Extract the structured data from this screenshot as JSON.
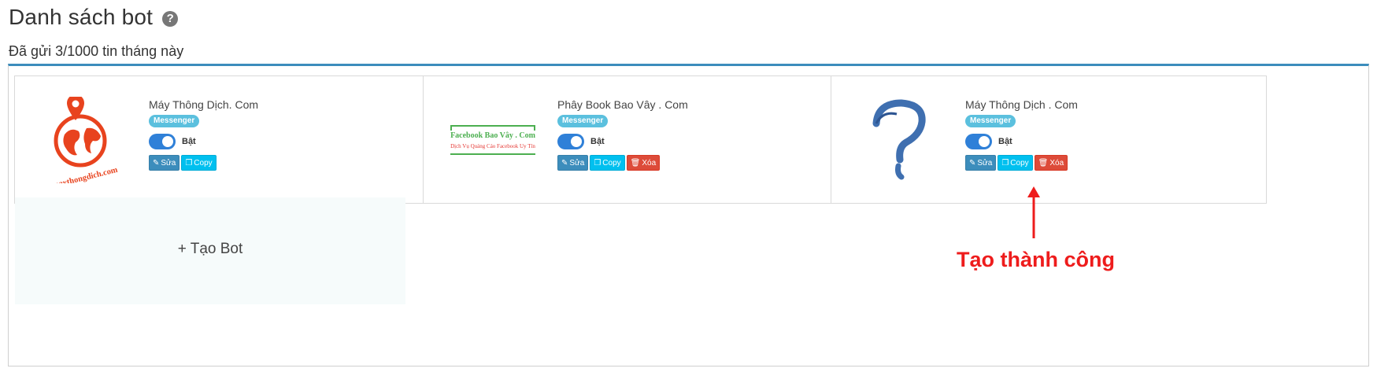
{
  "header": {
    "title": "Danh sách bot",
    "help_icon": "question-circle-icon",
    "sent_info": "Đã gửi 3/1000 tin tháng này"
  },
  "bots": [
    {
      "name": "Máy Thông Dịch. Com",
      "channel": "Messenger",
      "status_label": "Bật",
      "status_on": true,
      "logo": "maythongdich-globe-logo",
      "logo_text": "maythongdich.com",
      "edit_label": "Sửa",
      "copy_label": "Copy"
    },
    {
      "name": "Phây Book Bao Vây . Com",
      "channel": "Messenger",
      "status_label": "Bật",
      "status_on": true,
      "logo": "facebook-bao-vay-logo",
      "logo_line1": "Facebook Bao Vây . Com",
      "logo_line2": "Dịch Vụ Quảng Cáo Facebook Uy Tín",
      "edit_label": "Sửa",
      "copy_label": "Copy",
      "delete_label": "Xóa"
    },
    {
      "name": "Máy Thông Dịch . Com",
      "channel": "Messenger",
      "status_label": "Bật",
      "status_on": true,
      "logo": "question-mark-placeholder-logo",
      "edit_label": "Sửa",
      "copy_label": "Copy",
      "delete_label": "Xóa"
    }
  ],
  "create": {
    "label": "+ Tạo Bot"
  },
  "annotation": {
    "text": "Tạo thành công",
    "color": "#ee1c1c"
  },
  "colors": {
    "accent": "#3c8dbc",
    "toggle": "#2f80d8",
    "badge": "#5bc0de",
    "copy": "#00c0ef",
    "delete": "#dd4b39"
  }
}
